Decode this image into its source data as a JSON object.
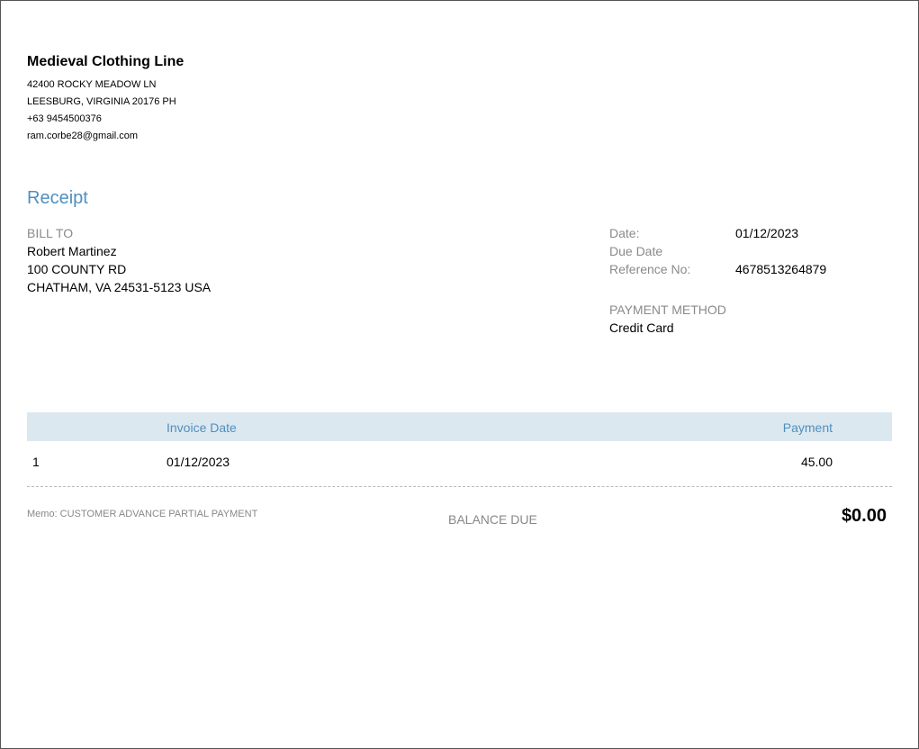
{
  "company": {
    "name": "Medieval Clothing Line",
    "address1": "42400 ROCKY MEADOW LN",
    "address2": "LEESBURG, VIRGINIA  20176 PH",
    "phone": "+63 9454500376",
    "email": "ram.corbe28@gmail.com"
  },
  "doc_title": "Receipt",
  "bill_to": {
    "label": "BILL TO",
    "name": "Robert Martinez",
    "address1": "100 COUNTY RD",
    "address2": "CHATHAM, VA  24531-5123 USA"
  },
  "meta": {
    "date_label": "Date:",
    "date": "01/12/2023",
    "due_label": "Due Date",
    "ref_label": "Reference No:",
    "ref": "4678513264879"
  },
  "payment_method": {
    "label": "PAYMENT METHOD",
    "value": "Credit Card"
  },
  "table": {
    "headers": [
      "",
      "Invoice Date",
      "Payment"
    ],
    "rows": [
      [
        "1",
        "01/12/2023",
        "45.00"
      ]
    ]
  },
  "memo": "Memo: CUSTOMER ADVANCE PARTIAL PAYMENT",
  "balance": {
    "label": "BALANCE DUE",
    "value": "$0.00"
  }
}
